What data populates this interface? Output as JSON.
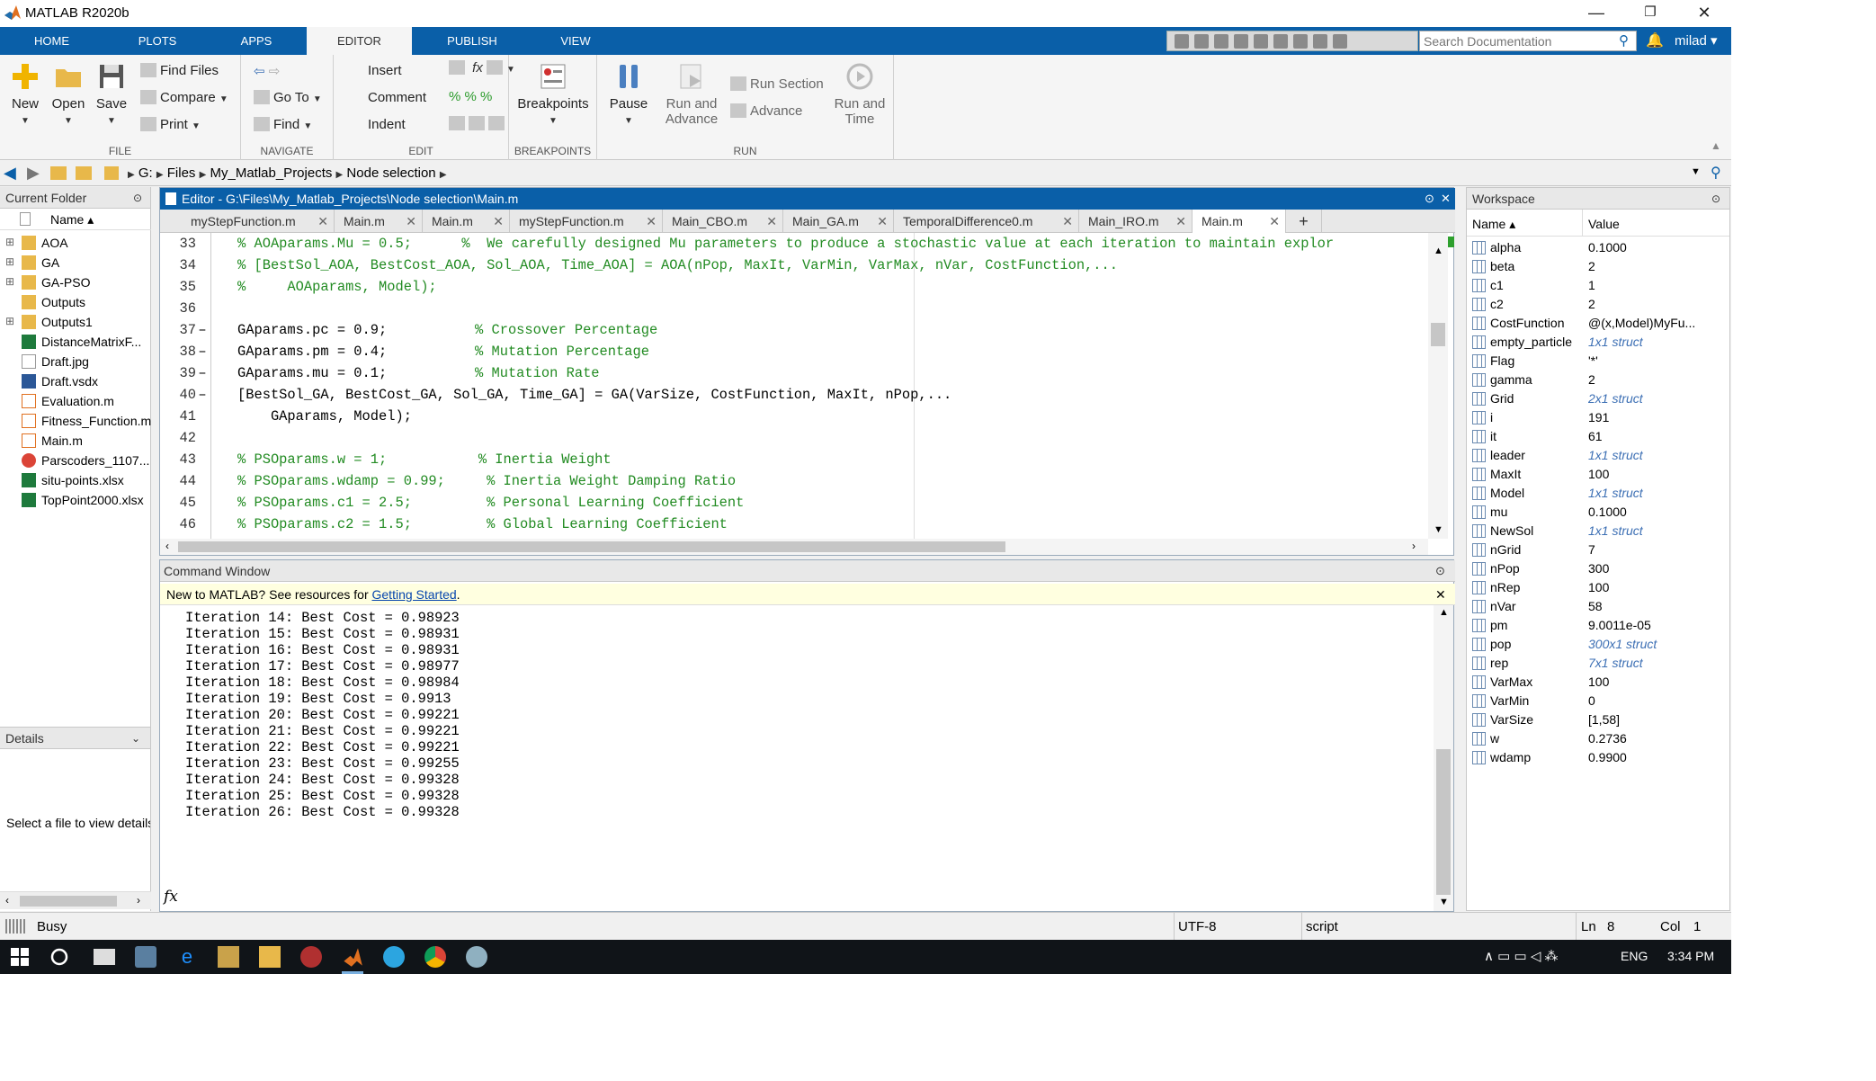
{
  "window": {
    "title": "MATLAB R2020b",
    "min": "—",
    "restore": "❐",
    "close": "✕"
  },
  "tabs": [
    "HOME",
    "PLOTS",
    "APPS",
    "EDITOR",
    "PUBLISH",
    "VIEW"
  ],
  "search": {
    "placeholder": "Search Documentation"
  },
  "user": "milad ▾",
  "ribbon": {
    "file": {
      "label": "FILE",
      "new": "New",
      "open": "Open",
      "save": "Save",
      "find_files": "Find Files",
      "compare": "Compare",
      "print": "Print"
    },
    "navigate": {
      "label": "NAVIGATE",
      "goto": "Go To",
      "find": "Find"
    },
    "edit": {
      "label": "EDIT",
      "insert": "Insert",
      "comment": "Comment",
      "indent": "Indent"
    },
    "breakpoints": {
      "label": "BREAKPOINTS",
      "btn": "Breakpoints"
    },
    "run": {
      "label": "RUN",
      "pause": "Pause",
      "run_advance_1": "Run and",
      "run_advance_2": "Advance",
      "run_section": "Run Section",
      "advance": "Advance",
      "run_time_1": "Run and",
      "run_time_2": "Time"
    }
  },
  "address": {
    "drive": "G:",
    "crumbs": [
      "Files",
      "My_Matlab_Projects",
      "Node selection"
    ]
  },
  "current_folder": {
    "title": "Current Folder",
    "col": "Name ▴",
    "items": [
      "AOA",
      "GA",
      "GA-PSO",
      "Outputs",
      "Outputs1",
      "DistanceMatrixF...",
      "Draft.jpg",
      "Draft.vsdx",
      "Evaluation.m",
      "Fitness_Function.m",
      "Main.m",
      "Parscoders_1107...",
      "situ-points.xlsx",
      "TopPoint2000.xlsx"
    ]
  },
  "details": {
    "title": "Details",
    "msg": "Select a file to view details"
  },
  "editor": {
    "title": "Editor - G:\\Files\\My_Matlab_Projects\\Node selection\\Main.m",
    "tabs": [
      "myStepFunction.m",
      "Main.m",
      "Main.m",
      "myStepFunction.m",
      "Main_CBO.m",
      "Main_GA.m",
      "TemporalDifference0.m",
      "Main_IRO.m",
      "Main.m"
    ],
    "lines": [
      {
        "n": "33",
        "d": "",
        "t": "% AOAparams.Mu = 0.5;      %  We carefully designed Mu parameters to produce a stochastic value at each iteration to maintain explor"
      },
      {
        "n": "34",
        "d": "",
        "t": "% [BestSol_AOA, BestCost_AOA, Sol_AOA, Time_AOA] = AOA(nPop, MaxIt, VarMin, VarMax, nVar, CostFunction,..."
      },
      {
        "n": "35",
        "d": "",
        "t": "%     AOAparams, Model);"
      },
      {
        "n": "36",
        "d": "",
        "t": ""
      },
      {
        "n": "37",
        "d": "–",
        "t": "GAparams.pc = 0.9;",
        "c": "% Crossover Percentage"
      },
      {
        "n": "38",
        "d": "–",
        "t": "GAparams.pm = 0.4;",
        "c": "% Mutation Percentage"
      },
      {
        "n": "39",
        "d": "–",
        "t": "GAparams.mu = 0.1;",
        "c": "% Mutation Rate"
      },
      {
        "n": "40",
        "d": "–",
        "t": "[BestSol_GA, BestCost_GA, Sol_GA, Time_GA] = GA(VarSize, CostFunction, MaxIt, nPop,..."
      },
      {
        "n": "41",
        "d": "",
        "t": "    GAparams, Model);"
      },
      {
        "n": "42",
        "d": "",
        "t": ""
      },
      {
        "n": "43",
        "d": "",
        "t": "% PSOparams.w = 1;           % Inertia Weight"
      },
      {
        "n": "44",
        "d": "",
        "t": "% PSOparams.wdamp = 0.99;     % Inertia Weight Damping Ratio"
      },
      {
        "n": "45",
        "d": "",
        "t": "% PSOparams.c1 = 2.5;         % Personal Learning Coefficient"
      },
      {
        "n": "46",
        "d": "",
        "t": "% PSOparams.c2 = 1.5;         % Global Learning Coefficient"
      }
    ]
  },
  "command": {
    "title": "Command Window",
    "banner_pre": "New to MATLAB? See resources for ",
    "banner_link": "Getting Started",
    "banner_post": ".",
    "prompt": "fx",
    "lines": [
      "Iteration 14: Best Cost = 0.98923",
      "Iteration 15: Best Cost = 0.98931",
      "Iteration 16: Best Cost = 0.98931",
      "Iteration 17: Best Cost = 0.98977",
      "Iteration 18: Best Cost = 0.98984",
      "Iteration 19: Best Cost = 0.9913",
      "Iteration 20: Best Cost = 0.99221",
      "Iteration 21: Best Cost = 0.99221",
      "Iteration 22: Best Cost = 0.99221",
      "Iteration 23: Best Cost = 0.99255",
      "Iteration 24: Best Cost = 0.99328",
      "Iteration 25: Best Cost = 0.99328",
      "Iteration 26: Best Cost = 0.99328"
    ]
  },
  "workspace": {
    "title": "Workspace",
    "col_name": "Name ▴",
    "col_value": "Value",
    "vars": [
      {
        "n": "alpha",
        "v": "0.1000"
      },
      {
        "n": "beta",
        "v": "2"
      },
      {
        "n": "c1",
        "v": "1"
      },
      {
        "n": "c2",
        "v": "2"
      },
      {
        "n": "CostFunction",
        "v": "@(x,Model)MyFu..."
      },
      {
        "n": "empty_particle",
        "v": "1x1 struct",
        "s": true
      },
      {
        "n": "Flag",
        "v": "'*'"
      },
      {
        "n": "gamma",
        "v": "2"
      },
      {
        "n": "Grid",
        "v": "2x1 struct",
        "s": true
      },
      {
        "n": "i",
        "v": "191"
      },
      {
        "n": "it",
        "v": "61"
      },
      {
        "n": "leader",
        "v": "1x1 struct",
        "s": true
      },
      {
        "n": "MaxIt",
        "v": "100"
      },
      {
        "n": "Model",
        "v": "1x1 struct",
        "s": true
      },
      {
        "n": "mu",
        "v": "0.1000"
      },
      {
        "n": "NewSol",
        "v": "1x1 struct",
        "s": true
      },
      {
        "n": "nGrid",
        "v": "7"
      },
      {
        "n": "nPop",
        "v": "300"
      },
      {
        "n": "nRep",
        "v": "100"
      },
      {
        "n": "nVar",
        "v": "58"
      },
      {
        "n": "pm",
        "v": "9.0011e-05"
      },
      {
        "n": "pop",
        "v": "300x1 struct",
        "s": true
      },
      {
        "n": "rep",
        "v": "7x1 struct",
        "s": true
      },
      {
        "n": "VarMax",
        "v": "100"
      },
      {
        "n": "VarMin",
        "v": "0"
      },
      {
        "n": "VarSize",
        "v": "[1,58]"
      },
      {
        "n": "w",
        "v": "0.2736"
      },
      {
        "n": "wdamp",
        "v": "0.9900"
      }
    ]
  },
  "status": {
    "busy": "Busy",
    "encoding": "UTF-8",
    "type": "script",
    "ln_label": "Ln",
    "ln": "8",
    "col_label": "Col",
    "col": "1"
  },
  "taskbar": {
    "lang": "ENG",
    "time": "3:34 PM"
  },
  "colors": {
    "accent": "#0a5fa8",
    "comment": "#228b22",
    "struct": "#3c6fb4"
  }
}
